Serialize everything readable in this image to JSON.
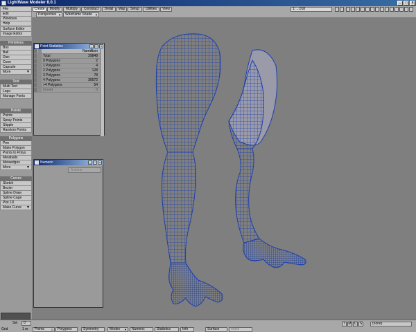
{
  "window": {
    "title": "LightWave Modeler 8.0.1",
    "min": "_",
    "max": "□",
    "close": "x"
  },
  "tabs": [
    "Create",
    "Modify",
    "Multiply",
    "Construct",
    "Detail",
    "Map",
    "Setup",
    "Utilities",
    "View"
  ],
  "active_tab": "Create",
  "viewport_header": {
    "view": "Perspective",
    "shade": "Wireframe Shade"
  },
  "layer_selector": "1: ...018",
  "sidebar": {
    "menus": [
      "File",
      "Edit",
      "Windows",
      "Help"
    ],
    "editors": [
      "Surface Editor",
      "Image Editor"
    ],
    "sections": [
      {
        "header": "Primitives",
        "items": [
          "Box",
          "Ball",
          "Disc",
          "Cone",
          "Capsule",
          "More"
        ]
      },
      {
        "header": "Text",
        "items": [
          "Multi Text",
          "Logo",
          "Manage Fonts"
        ]
      },
      {
        "header": "Points",
        "items": [
          "Points",
          "Spray Points",
          "Stipple",
          "Random Points"
        ]
      },
      {
        "header": "Polygons",
        "items": [
          "Pen",
          "Make Polygon",
          "Points to Polys",
          "Metaballs",
          "Metaedges",
          "More"
        ]
      },
      {
        "header": "Curves",
        "items": [
          "Sketch",
          "Bezier",
          "Spline Draw",
          "Spline Cage",
          "Plot 1D",
          "Make Curve"
        ]
      }
    ]
  },
  "point_statistics": {
    "title": "Point Statistics",
    "columns": {
      "name": "Name",
      "num": "Num"
    },
    "rows": [
      {
        "name": "Total",
        "num": "29848"
      },
      {
        "name": "0 Polygons",
        "num": "2"
      },
      {
        "name": "1 Polygons",
        "num": "4"
      },
      {
        "name": "2 Polygons",
        "num": "128"
      },
      {
        "name": "3 Polygons",
        "num": "78"
      },
      {
        "name": "4 Polygons",
        "num": "30572"
      },
      {
        "name": ">4 Polygons",
        "num": "54"
      },
      {
        "name": "(none)",
        "num": "0"
      }
    ]
  },
  "numeric": {
    "title": "Numeric",
    "action": "Actions"
  },
  "bottom": {
    "grid_label": "Grid",
    "grid_value": "1 m",
    "sel_label": "Sel",
    "sel_value": "0",
    "buttons": [
      "Points",
      "Polygons",
      "Symmetry",
      "Modes",
      "Numeric",
      "Statistics",
      "Info",
      "Surface",
      "Make"
    ],
    "points_shortcut": "G",
    "tmcs": [
      "T",
      "M",
      "C",
      "S"
    ],
    "none_value": "(none)"
  },
  "colors": {
    "wireframe": "#1a3fb0",
    "viewport": "#7f7f7f",
    "panel": "#9a9a9a",
    "titlebar": "#0a246a"
  }
}
